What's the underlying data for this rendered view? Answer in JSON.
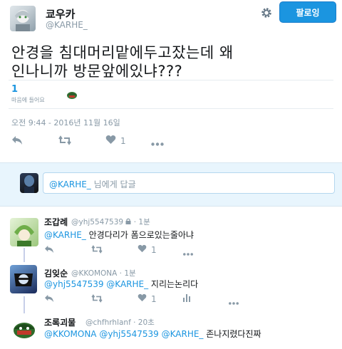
{
  "author": {
    "name": "쿄우카",
    "handle": "@KARHE_",
    "follow_label": "팔로잉"
  },
  "tweet": {
    "text_line1": "안경을 침대머리맡에두고잤는데 왜",
    "text_line2": "인나니까 방문앞에있냐???",
    "likes_count": "1",
    "likes_label": "마음에 들어요",
    "timestamp": "오전 9:44 - 2016년 11월 16일",
    "action_like_count": "1"
  },
  "reply_box": {
    "mention": "@KARHE_",
    "placeholder_suffix": " 님에게 답글"
  },
  "replies": [
    {
      "name": "조갑례",
      "handle": "@yhj5547539",
      "time": "· 1분",
      "mentions": "@KARHE_",
      "text": " 안경다리가 폼으로있는줄아냐",
      "like_count": "1"
    },
    {
      "name": "김잊순",
      "handle": "@KKOMONA",
      "time": "· 1분",
      "mentions": "@yhj5547539 @KARHE_",
      "text": " 지리는논리다",
      "like_count": "1"
    },
    {
      "name": "조록괴물",
      "handle": "@chfhrhlanf",
      "time": "· 20초",
      "mentions": "@KKOMONA @yhj5547539 @KARHE_",
      "text": " 존나지렸다진짜"
    }
  ],
  "colors": {
    "accent": "#1b95e0",
    "muted": "#8899a6",
    "reply_bg": "#e8f5fd"
  }
}
